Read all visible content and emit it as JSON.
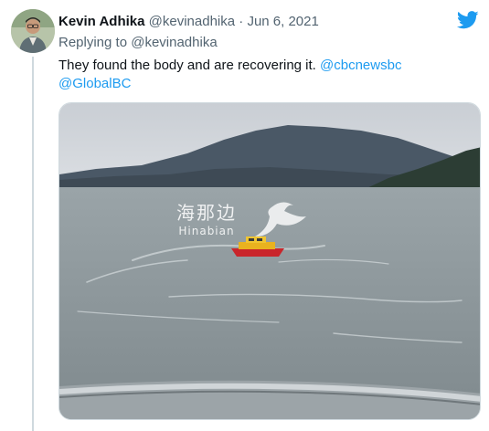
{
  "tweet": {
    "author_name": "Kevin Adhika",
    "author_handle": "@kevinadhika",
    "separator": "·",
    "date": "Jun 6, 2021",
    "replying_to_label": "Replying to",
    "replying_to_handle": "@kevinadhika",
    "text": "They found the body and are recovering it.",
    "mentions": [
      "@cbcnewsbc",
      "@GlobalBC"
    ]
  },
  "media": {
    "watermark_cn": "海那边",
    "watermark_en": "Hinabian"
  },
  "icons": {
    "brand": "twitter-bird-icon"
  },
  "colors": {
    "link": "#1d9bf0",
    "muted": "#536471",
    "brand": "#1d9bf0"
  }
}
